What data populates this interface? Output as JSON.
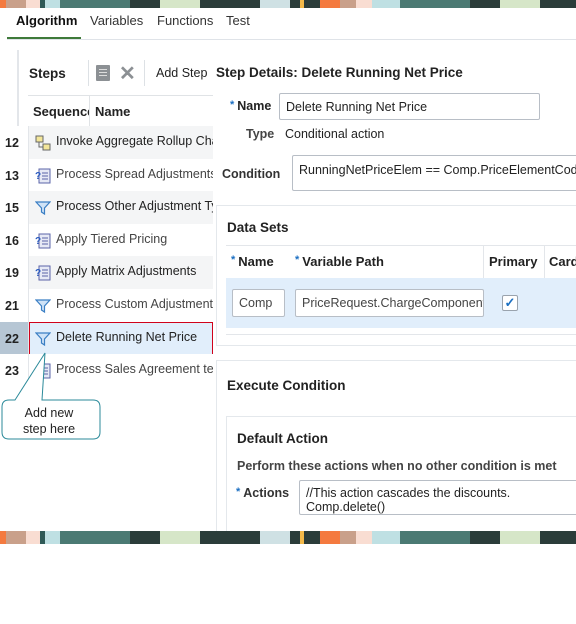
{
  "tabs": [
    "Algorithm",
    "Variables",
    "Functions",
    "Test"
  ],
  "active_tab": "Algorithm",
  "steps": {
    "title": "Steps",
    "add_step_label": "Add Step",
    "columns": [
      "Sequence",
      "Name"
    ],
    "rows": [
      {
        "seq": "12",
        "name": "Invoke Aggregate Rollup Charges",
        "icon": "aggregate-icon"
      },
      {
        "seq": "13",
        "name": "Process Spread Adjustments",
        "icon": "script-icon"
      },
      {
        "seq": "15",
        "name": "Process Other Adjustment Types",
        "icon": "filter-icon"
      },
      {
        "seq": "16",
        "name": "Apply Tiered Pricing",
        "icon": "script-icon"
      },
      {
        "seq": "19",
        "name": "Apply Matrix Adjustments",
        "icon": "script-icon"
      },
      {
        "seq": "21",
        "name": "Process Custom Adjustment Rules",
        "icon": "filter-icon"
      },
      {
        "seq": "22",
        "name": "Delete Running Net Price",
        "icon": "filter-icon",
        "selected": true
      },
      {
        "seq": "23",
        "name": "Process Sales Agreement terms",
        "icon": "script-icon"
      }
    ]
  },
  "callout": "Add new step here",
  "details": {
    "title": "Step Details: Delete Running Net Price",
    "name_label": "Name",
    "name_value": "Delete Running Net Price",
    "type_label": "Type",
    "type_value": "Conditional action",
    "condition_label": "Condition",
    "condition_value": "RunningNetPriceElem == Comp.PriceElementCode"
  },
  "data_sets": {
    "title": "Data Sets",
    "columns": [
      "Name",
      "Variable Path",
      "Primary",
      "Card"
    ],
    "row": {
      "name": "Comp",
      "path": "PriceRequest.ChargeComponent",
      "primary": true
    }
  },
  "execute": {
    "title": "Execute Condition",
    "default_title": "Default Action",
    "desc": "Perform these actions when no other condition is met",
    "actions_label": "Actions",
    "actions_line1": "//This action cascades the discounts.",
    "actions_line2": "Comp.delete()"
  },
  "colors": {
    "accent": "#3f7a3a",
    "selected_row": "#e1eefb",
    "highlight": "#d0021b",
    "callout": "#2b8a9a"
  }
}
